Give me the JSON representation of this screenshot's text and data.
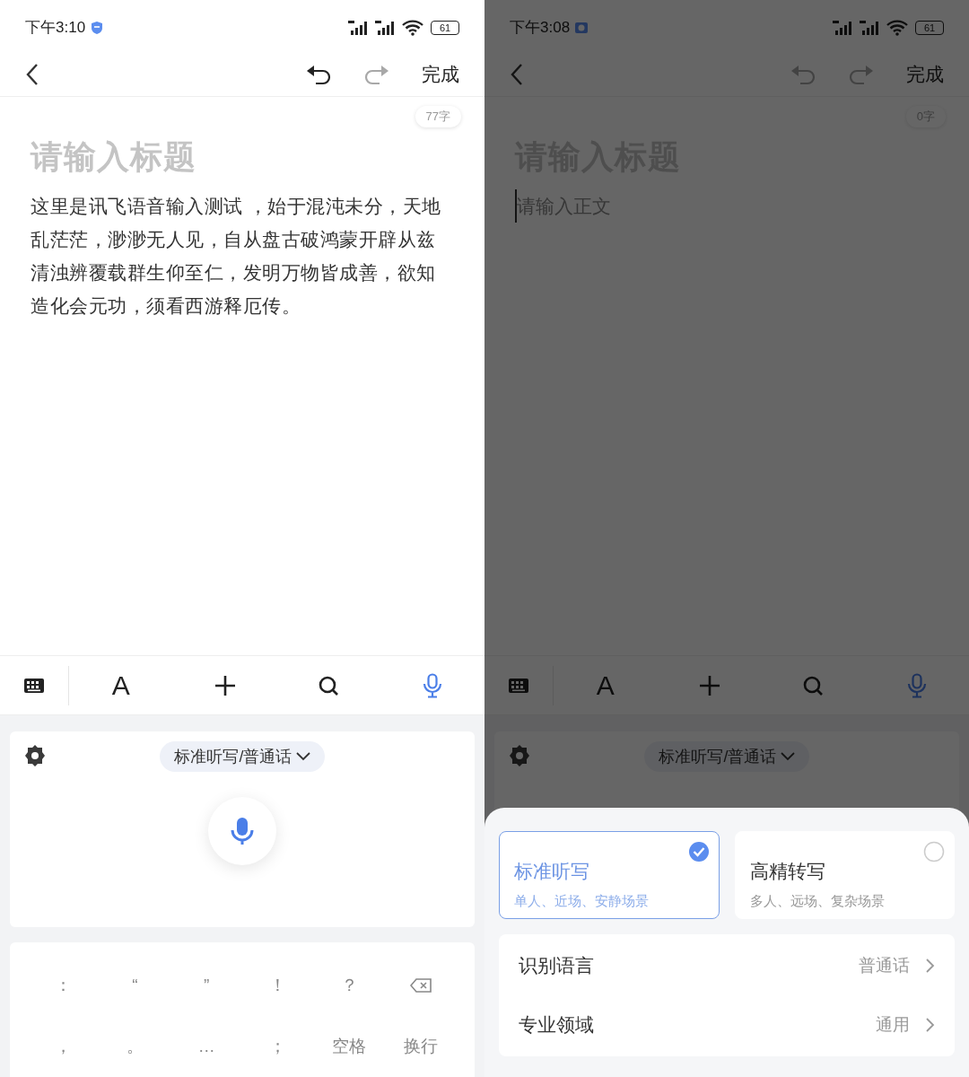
{
  "screens": [
    {
      "status": {
        "time": "下午3:10",
        "notice": {
          "kind": "shield"
        },
        "battery": "61"
      },
      "nav": {
        "undo": {
          "disabled": false
        },
        "redo": {
          "disabled": true
        },
        "done": "完成"
      },
      "editor": {
        "count": "77字",
        "title_placeholder": "请输入标题",
        "body": "这里是讯飞语音输入测试 ，始于混沌未分，天地乱茫茫，渺渺无人见，自从盘古破鸿蒙开辟从兹清浊辨覆载群生仰至仁，发明万物皆成善，欲知造化会元功，须看西游释厄传。"
      },
      "toolbar": [
        {
          "kind": "keyboard",
          "selected": false
        },
        {
          "kind": "font",
          "label": "A",
          "selected": false
        },
        {
          "kind": "add",
          "selected": false
        },
        {
          "kind": "search",
          "selected": false
        },
        {
          "kind": "voice",
          "selected": true
        }
      ],
      "voice": {
        "mode": "标准听写/普通话"
      },
      "keys": [
        [
          {
            "kind": "char",
            "label": "："
          },
          {
            "kind": "char",
            "label": "“"
          },
          {
            "kind": "char",
            "label": "”"
          },
          {
            "kind": "char",
            "label": "！"
          },
          {
            "kind": "char",
            "label": "？"
          },
          {
            "kind": "backspace"
          }
        ],
        [
          {
            "kind": "char",
            "label": "，"
          },
          {
            "kind": "char",
            "label": "。"
          },
          {
            "kind": "char",
            "label": "…"
          },
          {
            "kind": "char",
            "label": "；"
          },
          {
            "kind": "char",
            "label": "空格"
          },
          {
            "kind": "char",
            "label": "换行"
          }
        ]
      ]
    },
    {
      "status": {
        "time": "下午3:08",
        "notice": {
          "kind": "mail"
        },
        "battery": "61"
      },
      "nav": {
        "undo": {
          "disabled": true
        },
        "redo": {
          "disabled": true
        },
        "done": "完成"
      },
      "editor": {
        "count": "0字",
        "title_placeholder": "请输入标题",
        "body_placeholder": "请输入正文"
      },
      "toolbar": [
        {
          "kind": "keyboard",
          "selected": false
        },
        {
          "kind": "font",
          "label": "A",
          "selected": false
        },
        {
          "kind": "add",
          "selected": false
        },
        {
          "kind": "search",
          "selected": false
        },
        {
          "kind": "voice",
          "selected": true
        }
      ],
      "voice": {
        "mode": "标准听写/普通话"
      },
      "sheet": {
        "modes": [
          {
            "title": "标准听写",
            "subtitle": "单人、近场、安静场景",
            "selected": true
          },
          {
            "title": "高精转写",
            "subtitle": "多人、远场、复杂场景",
            "selected": false
          }
        ],
        "settings": [
          {
            "label": "识别语言",
            "value": "普通话"
          },
          {
            "label": "专业领域",
            "value": "通用"
          }
        ]
      }
    }
  ]
}
